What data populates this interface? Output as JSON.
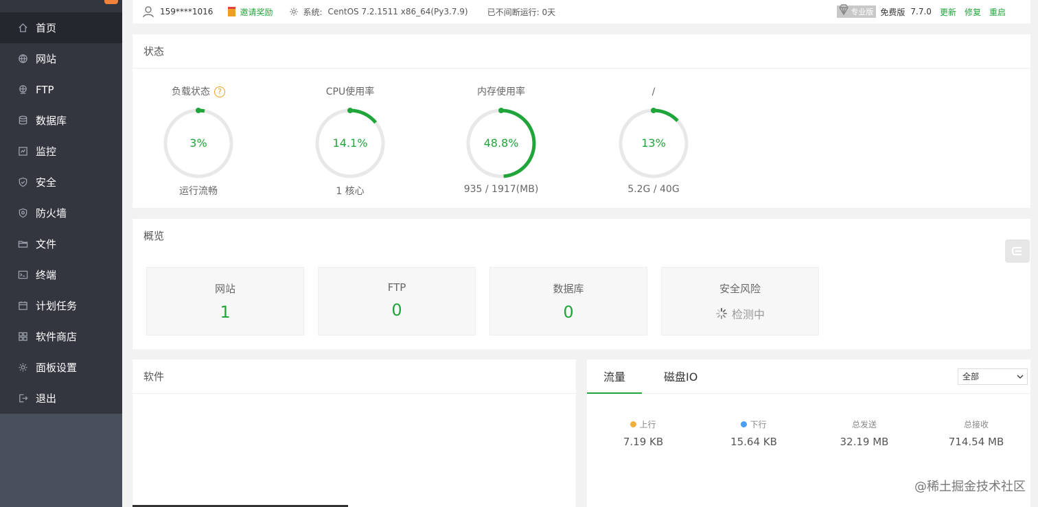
{
  "nav": {
    "items": [
      {
        "label": "首页",
        "icon": "home-icon"
      },
      {
        "label": "网站",
        "icon": "globe-icon"
      },
      {
        "label": "FTP",
        "icon": "ftp-icon"
      },
      {
        "label": "数据库",
        "icon": "database-icon"
      },
      {
        "label": "监控",
        "icon": "monitor-icon"
      },
      {
        "label": "安全",
        "icon": "shield-icon"
      },
      {
        "label": "防火墙",
        "icon": "firewall-icon"
      },
      {
        "label": "文件",
        "icon": "folder-icon"
      },
      {
        "label": "终端",
        "icon": "terminal-icon"
      },
      {
        "label": "计划任务",
        "icon": "calendar-icon"
      },
      {
        "label": "软件商店",
        "icon": "apps-icon"
      },
      {
        "label": "面板设置",
        "icon": "gear-icon"
      },
      {
        "label": "退出",
        "icon": "logout-icon"
      }
    ]
  },
  "topbar": {
    "user": "159****1016",
    "invite": "邀请奖励",
    "system_label": "系统:",
    "system_value": "CentOS 7.2.1511 x86_64(Py3.7.9)",
    "uptime": "已不间断运行: 0天",
    "pro_badge": "专业版",
    "edition": "免费版",
    "version": "7.7.0",
    "update": "更新",
    "repair": "修复",
    "restart": "重启"
  },
  "status": {
    "title": "状态",
    "gauges": [
      {
        "label": "负载状态",
        "value": "3%",
        "percent": 3,
        "sub": "运行流畅",
        "help": "?"
      },
      {
        "label": "CPU使用率",
        "value": "14.1%",
        "percent": 14.1,
        "sub": "1 核心"
      },
      {
        "label": "内存使用率",
        "value": "48.8%",
        "percent": 48.8,
        "sub": "935 / 1917(MB)"
      },
      {
        "label": "/",
        "value": "13%",
        "percent": 13,
        "sub": "5.2G / 40G"
      }
    ]
  },
  "overview": {
    "title": "概览",
    "cards": [
      {
        "title": "网站",
        "value": "1"
      },
      {
        "title": "FTP",
        "value": "0"
      },
      {
        "title": "数据库",
        "value": "0"
      },
      {
        "title": "安全风险",
        "value": "检测中"
      }
    ]
  },
  "software": {
    "title": "软件"
  },
  "traffic": {
    "tabs": [
      "流量",
      "磁盘IO"
    ],
    "select_value": "全部",
    "stats": [
      {
        "label": "上行",
        "value": "7.19 KB",
        "dot_color": "#f0b040"
      },
      {
        "label": "下行",
        "value": "15.64 KB",
        "dot_color": "#4a9ff5"
      },
      {
        "label": "总发送",
        "value": "32.19 MB"
      },
      {
        "label": "总接收",
        "value": "714.54 MB"
      }
    ]
  },
  "colors": {
    "accent": "#20a53a",
    "sidebar": "#33363f",
    "sidebar_active": "#25272e"
  },
  "watermark": "@稀土掘金技术社区"
}
